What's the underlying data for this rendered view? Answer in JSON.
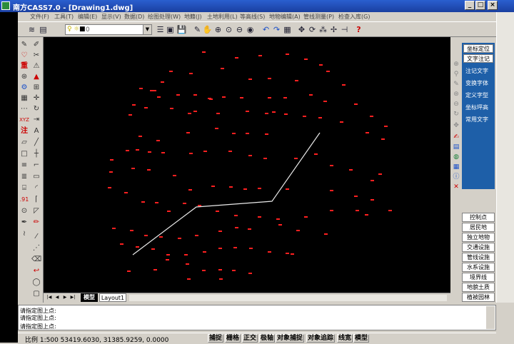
{
  "window": {
    "title": "南方CASS7.0 - [Drawing1.dwg]",
    "minimize": "_",
    "maximize": "□",
    "close": "×"
  },
  "menu": [
    {
      "label": "文件(F)"
    },
    {
      "label": "工具(T)"
    },
    {
      "label": "编辑(E)"
    },
    {
      "label": "显示(V)"
    },
    {
      "label": "数据(D)"
    },
    {
      "label": "绘图处理(W)"
    },
    {
      "label": "地籍(J)"
    },
    {
      "label": "土地利用(L)"
    },
    {
      "label": "等高线(S)"
    },
    {
      "label": "地物编辑(A)"
    },
    {
      "label": "管线测量(P)"
    },
    {
      "label": "检查入库(G)"
    }
  ],
  "toolbar": {
    "layer_value": "0"
  },
  "right_panel": {
    "top_buttons": [
      "坐标定位",
      "文字注记"
    ],
    "links": [
      "注记文字",
      "变换字体",
      "定义字型",
      "坐标坪高",
      "常用文字"
    ],
    "categories": [
      "控制点",
      "居民地",
      "独立地物",
      "交通设施",
      "管线设施",
      "水系设施",
      "境界线",
      "地貌土质",
      "植被园林"
    ]
  },
  "tabs": {
    "model": "模型",
    "layout": "Layout1"
  },
  "command": {
    "lines": [
      "请指定图上点:",
      "请指定图上点:",
      "请指定图上点:"
    ]
  },
  "status": {
    "coords": "比例 1:500 53419.6030, 31385.9259, 0.0000",
    "buttons": [
      "捕捉",
      "栅格",
      "正交",
      "极轴",
      "对象捕捉",
      "对象追踪",
      "线宽",
      "模型"
    ]
  },
  "drawing": {
    "point_color": "#ff2020",
    "polyline_color": "#e8e8e8"
  }
}
